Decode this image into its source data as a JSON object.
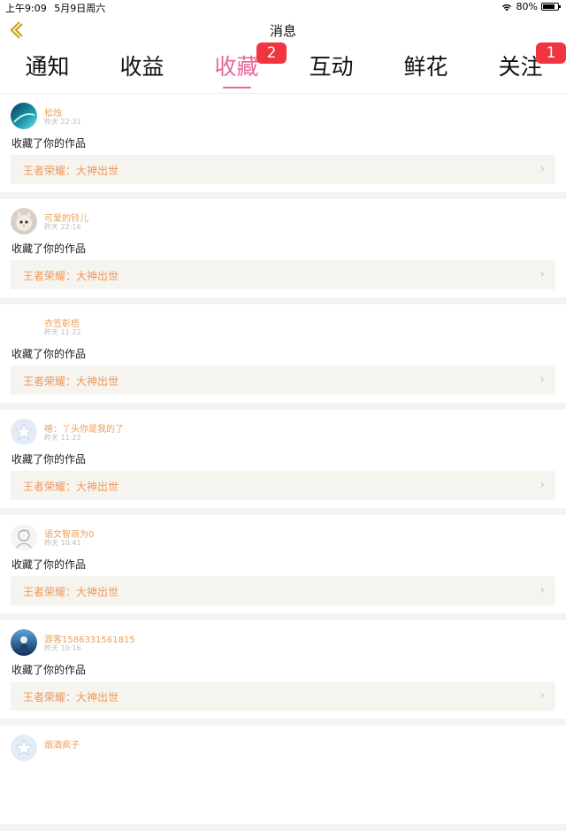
{
  "status": {
    "time": "上午9:09",
    "date": "5月9日周六",
    "battery": "80%",
    "battery_level": 0.8
  },
  "nav": {
    "title": "消息"
  },
  "tabs": [
    {
      "label": "通知",
      "badge": ""
    },
    {
      "label": "收益",
      "badge": ""
    },
    {
      "label": "收藏",
      "badge": "2"
    },
    {
      "label": "互动",
      "badge": ""
    },
    {
      "label": "鲜花",
      "badge": ""
    },
    {
      "label": "关注",
      "badge": "1"
    }
  ],
  "active_tab": 2,
  "colors": {
    "accent": "#e8669c",
    "badge": "#f0353f",
    "name": "#e9a15a",
    "work_title": "#f0975a",
    "card_bg": "#f5f4ef"
  },
  "items": [
    {
      "name": "松烛",
      "time": "昨天 22:31",
      "action": "收藏了你的作品",
      "work": "王者荣耀：大神出世",
      "avatar": "teal"
    },
    {
      "name": "可爱的铃儿",
      "time": "昨天 22:16",
      "action": "收藏了你的作品",
      "work": "王者荣耀：大神出世",
      "avatar": "cat"
    },
    {
      "name": "衣笠彰梧",
      "time": "昨天 11:22",
      "action": "收藏了你的作品",
      "work": "王者荣耀：大神出世",
      "avatar": "none"
    },
    {
      "name": "噫：丫头你是我的了",
      "time": "昨天 11:22",
      "action": "收藏了你的作品",
      "work": "王者荣耀：大神出世",
      "avatar": "star"
    },
    {
      "name": "语文智商为0",
      "time": "昨天 10:41",
      "action": "收藏了你的作品",
      "work": "王者荣耀：大神出世",
      "avatar": "sketch"
    },
    {
      "name": "游客1586331561815",
      "time": "昨天 10:16",
      "action": "收藏了你的作品",
      "work": "王者荣耀：大神出世",
      "avatar": "blue"
    },
    {
      "name": "烟酒疯子",
      "time": "",
      "action": "",
      "work": "",
      "avatar": "star"
    }
  ]
}
